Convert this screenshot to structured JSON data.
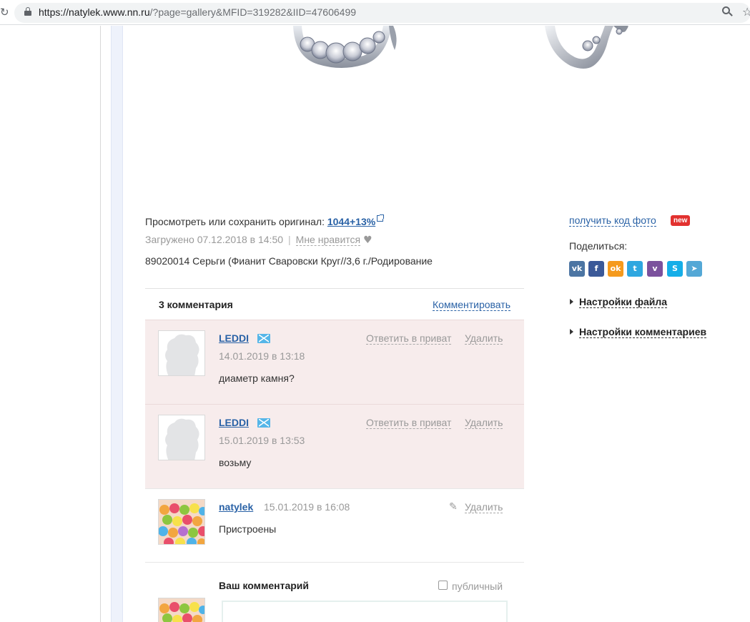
{
  "browser": {
    "url_host": "https://natylek.www.nn.ru",
    "url_rest": "/?page=gallery&MFID=319282&IID=47606499"
  },
  "photo": {
    "original_label": "Просмотреть или сохранить оригинал:",
    "original_link": "1044+13%",
    "uploaded": "Загружено 07.12.2018 в 14:50",
    "separator": "|",
    "like_label": "Мне нравится",
    "description": "89020014 Серьги (Фианит Сваровски Круг//3,6 г./Родирование"
  },
  "comments": {
    "count_label": "3 комментария",
    "add_label": "Комментировать",
    "items": [
      {
        "author": "LEDDI",
        "date": "14.01.2019 в 13:18",
        "text": "диаметр камня?",
        "reply_private": "Ответить в приват",
        "delete": "Удалить"
      },
      {
        "author": "LEDDI",
        "date": "15.01.2019 в 13:53",
        "text": "возьму",
        "reply_private": "Ответить в приват",
        "delete": "Удалить"
      },
      {
        "author": "natylek",
        "date": "15.01.2019 в 16:08",
        "text": "Пристроены",
        "delete": "Удалить"
      }
    ]
  },
  "form": {
    "label": "Ваш комментарий",
    "public_label": "публичный"
  },
  "sidebar": {
    "code_link": "получить код фото",
    "new_badge": "new",
    "share_label": "Поделиться:",
    "socials": [
      {
        "name": "vk",
        "glyph": "vk",
        "color": "#4c75a3"
      },
      {
        "name": "facebook",
        "glyph": "f",
        "color": "#3b5998"
      },
      {
        "name": "odnoklassniki",
        "glyph": "ok",
        "color": "#f59a1d"
      },
      {
        "name": "twitter",
        "glyph": "t",
        "color": "#2ea7e0"
      },
      {
        "name": "viber",
        "glyph": "v",
        "color": "#7b519d"
      },
      {
        "name": "skype",
        "glyph": "S",
        "color": "#15aee8"
      },
      {
        "name": "telegram",
        "glyph": "➤",
        "color": "#54a8d6"
      }
    ],
    "file_settings": "Настройки файла",
    "comment_settings": "Настройки комментариев"
  },
  "colors": {
    "link": "#2a62a6",
    "comment_highlight": "#f7ecec",
    "new_badge": "#e2312f"
  }
}
